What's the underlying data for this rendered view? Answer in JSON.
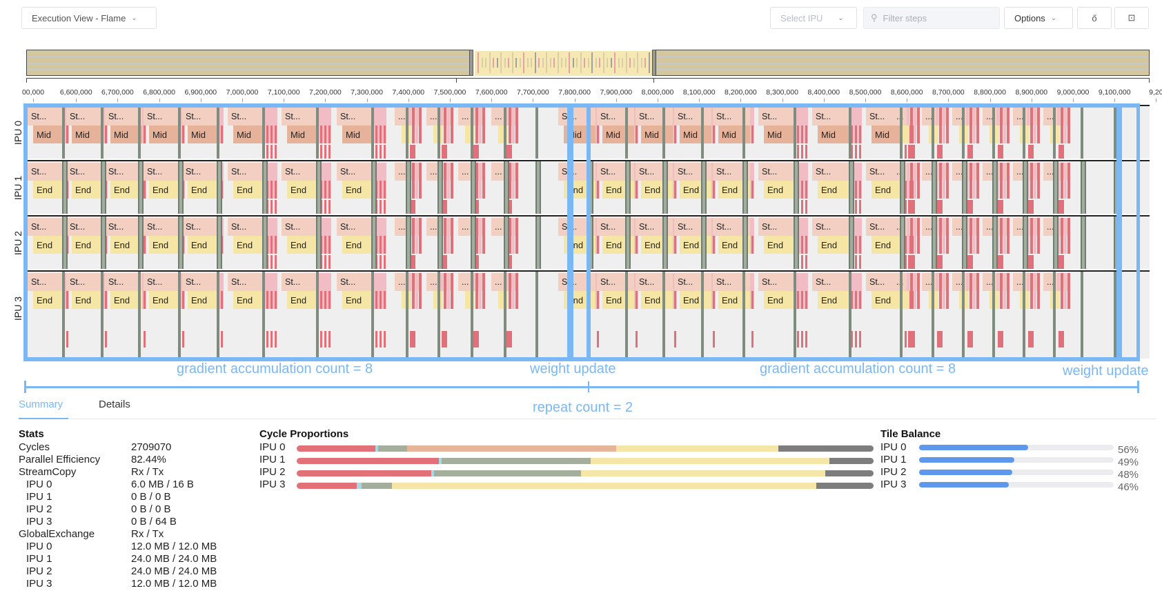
{
  "toolbar": {
    "view_select": "Execution View - Flame",
    "ipu_select_placeholder": "Select IPU",
    "filter_placeholder": "Filter steps",
    "options_label": "Options",
    "font_icon": "ő",
    "camera_icon": "⊡"
  },
  "axis": {
    "labels": [
      "00,000",
      "6,600,000",
      "6,700,000",
      "6,800,000",
      "6,900,000",
      "7,000,000",
      "7,100,000",
      "7,200,000",
      "7,300,000",
      "7,400,000",
      "7,500,000",
      "7,600,000",
      "7,700,000",
      "7,800,000",
      "7,900,000",
      "8,000,000",
      "8,100,000",
      "8,200,000",
      "8,300,000",
      "8,400,000",
      "8,500,000",
      "8,600,000",
      "8,700,000",
      "8,800,000",
      "8,900,000",
      "9,000,000",
      "9,100,000",
      "9,20"
    ]
  },
  "lanes": [
    {
      "label": "IPU 0",
      "top_text": "St...",
      "bottom_text": "Mid",
      "kind": "mid"
    },
    {
      "label": "IPU 1",
      "top_text": "St...",
      "bottom_text": "End",
      "kind": "end"
    },
    {
      "label": "IPU 2",
      "top_text": "St...",
      "bottom_text": "End",
      "kind": "end"
    },
    {
      "label": "IPU 3",
      "top_text": "St...",
      "bottom_text": "End",
      "kind": "end"
    }
  ],
  "annotations": {
    "grad_acc_1": "gradient accumulation count = 8",
    "weight_update_1": "weight update",
    "grad_acc_2": "gradient accumulation count = 8",
    "weight_update_2": "weight update",
    "repeat_count": "repeat count = 2"
  },
  "tabs": [
    {
      "label": "Summary",
      "active": true
    },
    {
      "label": "Details",
      "active": false
    }
  ],
  "stats": {
    "title": "Stats",
    "rows": [
      {
        "label": "Cycles",
        "value": "2709070",
        "indent": false
      },
      {
        "label": "Parallel Efficiency",
        "value": "82.44%",
        "indent": false
      },
      {
        "label": "StreamCopy",
        "value": "Rx / Tx",
        "indent": false
      },
      {
        "label": "IPU 0",
        "value": "6.0 MB / 16 B",
        "indent": true
      },
      {
        "label": "IPU 1",
        "value": "0 B / 0 B",
        "indent": true
      },
      {
        "label": "IPU 2",
        "value": "0 B / 0 B",
        "indent": true
      },
      {
        "label": "IPU 3",
        "value": "0 B / 64 B",
        "indent": true
      },
      {
        "label": "GlobalExchange",
        "value": "Rx / Tx",
        "indent": false
      },
      {
        "label": "IPU 0",
        "value": "12.0 MB / 12.0 MB",
        "indent": true
      },
      {
        "label": "IPU 1",
        "value": "24.0 MB / 24.0 MB",
        "indent": true
      },
      {
        "label": "IPU 2",
        "value": "24.0 MB / 24.0 MB",
        "indent": true
      },
      {
        "label": "IPU 3",
        "value": "12.0 MB / 12.0 MB",
        "indent": true
      }
    ]
  },
  "cycle_proportions": {
    "title": "Cycle Proportions",
    "colors": {
      "red": "#e27078",
      "teal": "#a8d8e4",
      "green": "#a4ae9c",
      "orange": "#e7b59a",
      "yellow": "#f5e6a8",
      "gray": "#7d7d7d"
    },
    "rows": [
      {
        "label": "IPU 0",
        "segments": [
          {
            "c": "red",
            "p": 13.6
          },
          {
            "c": "teal",
            "p": 0.5
          },
          {
            "c": "green",
            "p": 5.1
          },
          {
            "c": "orange",
            "p": 36.2
          },
          {
            "c": "yellow",
            "p": 28.1
          },
          {
            "c": "gray",
            "p": 16.5
          }
        ]
      },
      {
        "label": "IPU 1",
        "segments": [
          {
            "c": "red",
            "p": 24.6
          },
          {
            "c": "teal",
            "p": 0.5
          },
          {
            "c": "green",
            "p": 25.9
          },
          {
            "c": "yellow",
            "p": 41.3
          },
          {
            "c": "gray",
            "p": 7.7
          }
        ]
      },
      {
        "label": "IPU 2",
        "segments": [
          {
            "c": "red",
            "p": 23.3
          },
          {
            "c": "teal",
            "p": 0.5
          },
          {
            "c": "green",
            "p": 25.5
          },
          {
            "c": "yellow",
            "p": 42.3
          },
          {
            "c": "gray",
            "p": 8.4
          }
        ]
      },
      {
        "label": "IPU 3",
        "segments": [
          {
            "c": "red",
            "p": 10.4
          },
          {
            "c": "teal",
            "p": 0.8
          },
          {
            "c": "green",
            "p": 5.3
          },
          {
            "c": "yellow",
            "p": 73.6
          },
          {
            "c": "gray",
            "p": 9.9
          }
        ]
      }
    ]
  },
  "tile_balance": {
    "title": "Tile Balance",
    "rows": [
      {
        "label": "IPU 0",
        "value": 56,
        "pct": "56%"
      },
      {
        "label": "IPU 1",
        "value": 49,
        "pct": "49%"
      },
      {
        "label": "IPU 2",
        "value": 48,
        "pct": "48%"
      },
      {
        "label": "IPU 3",
        "value": 46,
        "pct": "46%"
      }
    ]
  }
}
